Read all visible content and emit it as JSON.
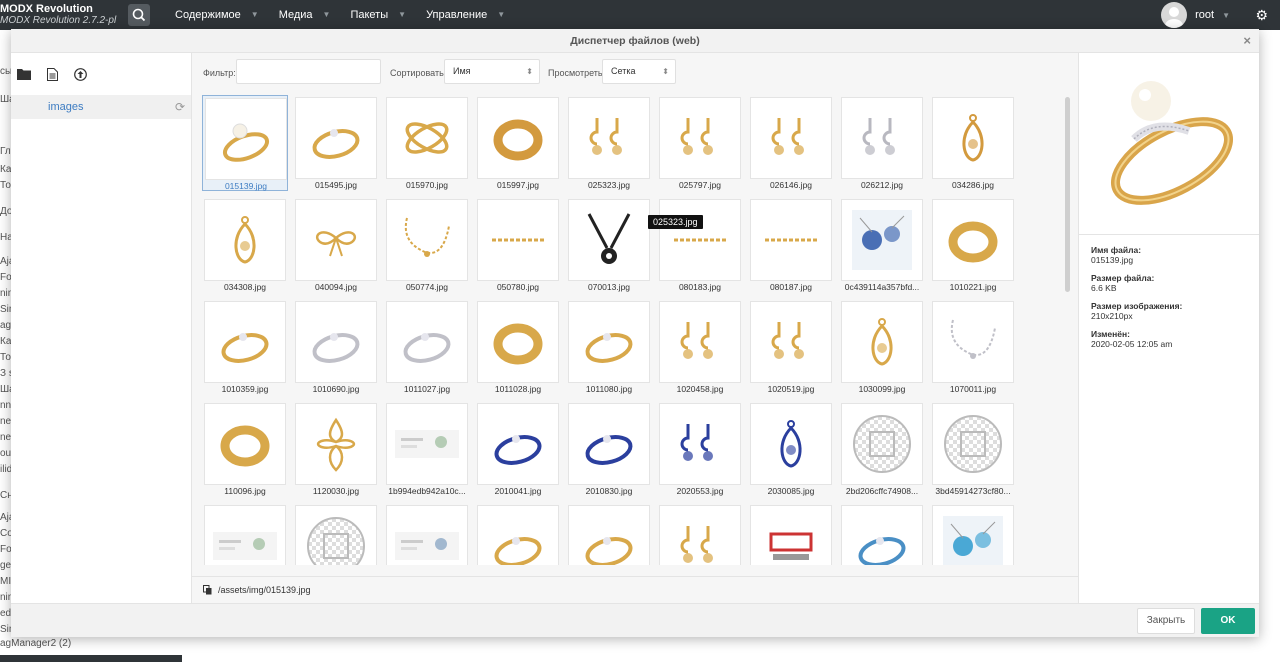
{
  "app": {
    "name": "MODX Revolution",
    "version": "MODX Revolution 2.7.2-pl"
  },
  "nav": [
    "Содержимое",
    "Медиа",
    "Пакеты",
    "Управление"
  ],
  "user": {
    "name": "root"
  },
  "bg_sidebar": [
    "сы",
    "Ша",
    "Гла",
    "Кат",
    "Тов",
    "До",
    "На",
    "Aja",
    "For",
    "nin",
    "Sim",
    "agl",
    "Кат",
    "Тов",
    "З s",
    "Ша",
    "nne",
    "ner",
    "ner",
    "out",
    "ilid",
    "Сн",
    "Aja",
    "Col",
    "For",
    "get",
    "MIC",
    "nin",
    "edo",
    "Sim",
    "agManager2 (2)"
  ],
  "modal": {
    "title": "Диспетчер файлов (web)",
    "tree_node": "images",
    "filter": {
      "label": "Фильтр:",
      "value": "",
      "sort_label": "Сортировать:",
      "sort_value": "Имя",
      "view_label": "Просмотреть:",
      "view_value": "Сетка"
    },
    "tooltip": "025323.jpg",
    "path": "/assets/img/015139.jpg",
    "files": [
      {
        "name": "015139.jpg",
        "kind": "ring-pearl",
        "color": "#d8a84a"
      },
      {
        "name": "015495.jpg",
        "kind": "ring",
        "color": "#d8a84a"
      },
      {
        "name": "015970.jpg",
        "kind": "ring-x",
        "color": "#d8a84a"
      },
      {
        "name": "015997.jpg",
        "kind": "ring-wide",
        "color": "#d39a3e"
      },
      {
        "name": "025323.jpg",
        "kind": "earrings",
        "color": "#d8a84a"
      },
      {
        "name": "025797.jpg",
        "kind": "earrings",
        "color": "#d8a84a"
      },
      {
        "name": "026146.jpg",
        "kind": "earrings",
        "color": "#d8a84a"
      },
      {
        "name": "026212.jpg",
        "kind": "earrings",
        "color": "#b8b8c0"
      },
      {
        "name": "034286.jpg",
        "kind": "pendant",
        "color": "#d39a3e"
      },
      {
        "name": "034308.jpg",
        "kind": "pendant",
        "color": "#d8a84a"
      },
      {
        "name": "040094.jpg",
        "kind": "bow",
        "color": "#d8a84a"
      },
      {
        "name": "050774.jpg",
        "kind": "chain",
        "color": "#d8a84a"
      },
      {
        "name": "050780.jpg",
        "kind": "bracelet",
        "color": "#d8a84a"
      },
      {
        "name": "070013.jpg",
        "kind": "cord",
        "color": "#222222"
      },
      {
        "name": "080183.jpg",
        "kind": "bracelet",
        "color": "#d8a84a"
      },
      {
        "name": "080187.jpg",
        "kind": "bracelet",
        "color": "#d8a84a"
      },
      {
        "name": "0c439114a357bfd...",
        "kind": "photo-blue",
        "color": "#4a6fb5"
      },
      {
        "name": "1010221.jpg",
        "kind": "ring-wide",
        "color": "#d8a84a"
      },
      {
        "name": "1010359.jpg",
        "kind": "ring",
        "color": "#d8a84a"
      },
      {
        "name": "1010690.jpg",
        "kind": "ring",
        "color": "#c0c0c8"
      },
      {
        "name": "1011027.jpg",
        "kind": "ring",
        "color": "#c0c0c8"
      },
      {
        "name": "1011028.jpg",
        "kind": "ring-wide",
        "color": "#d8a84a"
      },
      {
        "name": "1011080.jpg",
        "kind": "ring",
        "color": "#d8a84a"
      },
      {
        "name": "1020458.jpg",
        "kind": "earrings",
        "color": "#d8a84a"
      },
      {
        "name": "1020519.jpg",
        "kind": "earrings",
        "color": "#d8a84a"
      },
      {
        "name": "1030099.jpg",
        "kind": "pendant",
        "color": "#d8a84a"
      },
      {
        "name": "1070011.jpg",
        "kind": "chain",
        "color": "#c0c0c8"
      },
      {
        "name": "110096.jpg",
        "kind": "ring-wide",
        "color": "#d8a84a"
      },
      {
        "name": "1120030.jpg",
        "kind": "cross",
        "color": "#d8a84a"
      },
      {
        "name": "1b994edb942a10c...",
        "kind": "banner",
        "color": "#8bb08b"
      },
      {
        "name": "2010041.jpg",
        "kind": "ring",
        "color": "#2b3f9e"
      },
      {
        "name": "2010830.jpg",
        "kind": "ring",
        "color": "#2b3f9e"
      },
      {
        "name": "2020553.jpg",
        "kind": "earrings",
        "color": "#2b3f9e"
      },
      {
        "name": "2030085.jpg",
        "kind": "pendant",
        "color": "#2b3f9e"
      },
      {
        "name": "2bd206cffc74908...",
        "kind": "checker",
        "color": "#bbbbbb"
      },
      {
        "name": "3bd45914273cf80...",
        "kind": "checker",
        "color": "#bbbbbb"
      },
      {
        "name": "",
        "kind": "banner",
        "color": "#8bb08b"
      },
      {
        "name": "",
        "kind": "checker",
        "color": "#bbbbbb"
      },
      {
        "name": "",
        "kind": "banner",
        "color": "#6a8fb5"
      },
      {
        "name": "",
        "kind": "ring",
        "color": "#d8a84a"
      },
      {
        "name": "",
        "kind": "ring",
        "color": "#d8a84a"
      },
      {
        "name": "",
        "kind": "earrings",
        "color": "#d8a84a"
      },
      {
        "name": "",
        "kind": "logo",
        "color": "#cc3333"
      },
      {
        "name": "",
        "kind": "ring",
        "color": "#4a8fc5"
      },
      {
        "name": "",
        "kind": "photo-blue",
        "color": "#4aa8d5"
      }
    ],
    "selected_index": 0,
    "info": [
      {
        "k": "Имя файла:",
        "v": "015139.jpg"
      },
      {
        "k": "Размер файла:",
        "v": "6.6 KB"
      },
      {
        "k": "Размер изображения:",
        "v": "210x210px"
      },
      {
        "k": "Изменён:",
        "v": "2020-02-05 12:05 am"
      }
    ],
    "buttons": {
      "close": "Закрыть",
      "ok": "OK"
    }
  }
}
